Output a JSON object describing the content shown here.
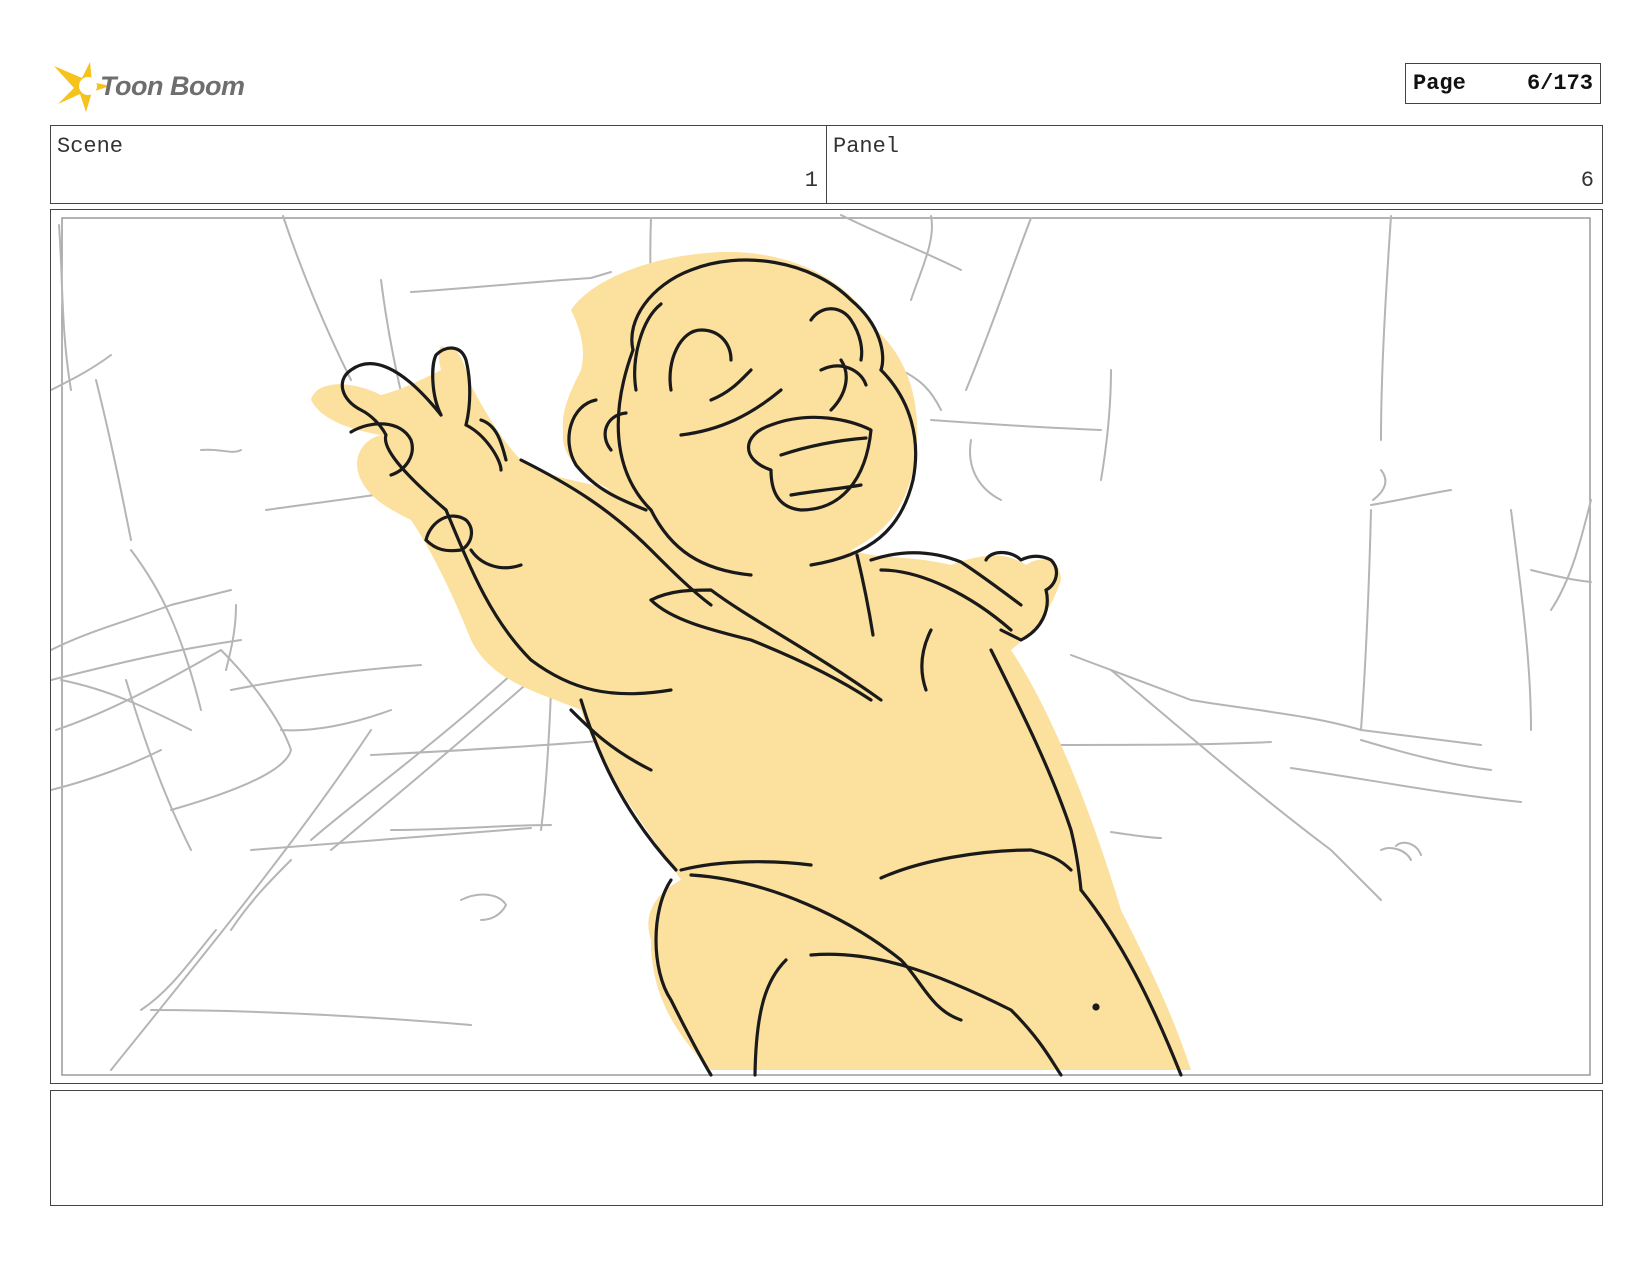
{
  "brand": {
    "name": "Toon Boom",
    "accent": "#F6C21C"
  },
  "page": {
    "label": "Page",
    "value": "6/173"
  },
  "scene": {
    "label": "Scene",
    "value": "1"
  },
  "panel": {
    "label": "Panel",
    "value": "6"
  },
  "drawing": {
    "fill": "#FCE09D",
    "ink": "#1a1a1a",
    "sketch": "#b5b5b5"
  },
  "notes": {
    "text": ""
  }
}
